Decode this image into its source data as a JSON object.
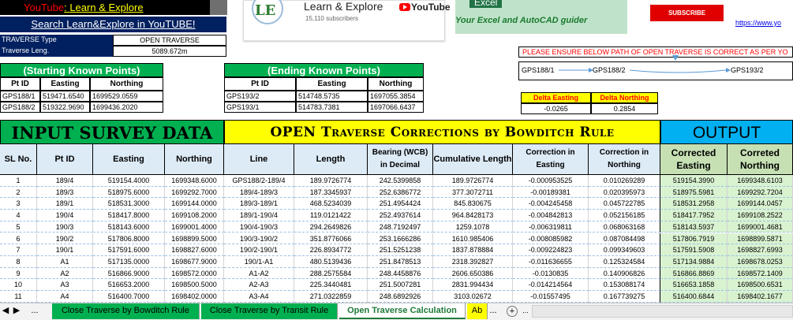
{
  "youtube_banner": {
    "prefix": "YouTube",
    "sep": ": ",
    "channel": "Learn & Explore"
  },
  "subscribe_banner": "Search Learn&Explore in YouTUBE!",
  "traverse_info": {
    "type_label": "TRAVERSE Type",
    "type_value": "OPEN TRAVERSE",
    "length_label": "Traverse Leng.",
    "length_value": "5089.672m"
  },
  "starting_points": {
    "title": "(Starting Known Points)",
    "headers": [
      "Pt ID",
      "Easting",
      "Northing"
    ],
    "rows": [
      [
        "GPS188/1",
        "519471.6540",
        "1699529.0559"
      ],
      [
        "GPS188/2",
        "519322.9690",
        "1699436.2020"
      ]
    ]
  },
  "ending_points": {
    "title": "(Ending Known Points)",
    "headers": [
      "Pt ID",
      "Easting",
      "Northing"
    ],
    "rows": [
      [
        "GPS193/2",
        "514748.5735",
        "1697055.3854"
      ],
      [
        "GPS193/1",
        "514783.7381",
        "1697066.6437"
      ]
    ]
  },
  "yt_card": {
    "logo": "LE",
    "channel": "Learn & Explore",
    "subscribers": "15,110 subscribers",
    "brand": "YouTube"
  },
  "excel_banner": {
    "tag": "Excel",
    "guide": "Your Excel and AutoCAD guider"
  },
  "subscribe_button": "SUBSCRIBE",
  "url_text": "https://www.yo",
  "warning": "PLEASE ENSURE BELOW PATH OF OPEN TRAVERSE IS CORRECT AS PER YO",
  "path": {
    "p1": "GPS188/1",
    "p2": "GPS188/2",
    "p3": "GPS193/2"
  },
  "delta": {
    "easting_label": "Delta Easting",
    "northing_label": "Delta Northing",
    "easting_value": "-0.0265",
    "northing_value": "0.2854"
  },
  "titles": {
    "input": "INPUT SURVEY DATA",
    "bowditch": "OPEN Traverse Corrections by Bowditch Rule",
    "output": "OUTPUT"
  },
  "table_headers": {
    "sl": "SL No.",
    "pt": "Pt ID",
    "easting": "Easting",
    "northing": "Northing",
    "line": "Line",
    "length": "Length",
    "bearing": "Bearing (WCB) in Decimal",
    "cumulative": "Cumulative Length",
    "corr_e": "Correction in Easting",
    "corr_n": "Correction in Northing",
    "cor_e": "Corrected Easting",
    "cor_n": "Correted Northing"
  },
  "rows": [
    [
      "1",
      "189/4",
      "519154.4000",
      "1699348.6000",
      "GPS188/2-189/4",
      "189.9726774",
      "242.5399858",
      "189.9726774",
      "-0.000953525",
      "0.010269289",
      "519154.3990",
      "1699348.6103"
    ],
    [
      "2",
      "189/3",
      "518975.6000",
      "1699292.7000",
      "189/4-189/3",
      "187.3345937",
      "252.6386772",
      "377.3072711",
      "-0.00189381",
      "0.020395973",
      "518975.5981",
      "1699292.7204"
    ],
    [
      "3",
      "189/1",
      "518531.3000",
      "1699144.0000",
      "189/3-189/1",
      "468.5234039",
      "251.4954424",
      "845.830675",
      "-0.004245458",
      "0.045722785",
      "518531.2958",
      "1699144.0457"
    ],
    [
      "4",
      "190/4",
      "518417.8000",
      "1699108.2000",
      "189/1-190/4",
      "119.0121422",
      "252.4937614",
      "964.8428173",
      "-0.004842813",
      "0.052156185",
      "518417.7952",
      "1699108.2522"
    ],
    [
      "5",
      "190/3",
      "518143.6000",
      "1699001.4000",
      "190/4-190/3",
      "294.2649826",
      "248.7192497",
      "1259.1078",
      "-0.006319811",
      "0.068063168",
      "518143.5937",
      "1699001.4681"
    ],
    [
      "6",
      "190/2",
      "517806.8000",
      "1698899.5000",
      "190/3-190/2",
      "351.8776066",
      "253.1666286",
      "1610.985406",
      "-0.008085982",
      "0.087084498",
      "517806.7919",
      "1698899.5871"
    ],
    [
      "7",
      "190/1",
      "517591.6000",
      "1698827.6000",
      "190/2-190/1",
      "226.8934772",
      "251.5251238",
      "1837.878884",
      "-0.009224823",
      "0.099349603",
      "517591.5908",
      "1698827.6993"
    ],
    [
      "8",
      "A1",
      "517135.0000",
      "1698677.9000",
      "190/1-A1",
      "480.5139436",
      "251.8478513",
      "2318.392827",
      "-0.011636655",
      "0.125324584",
      "517134.9884",
      "1698678.0253"
    ],
    [
      "9",
      "A2",
      "516866.9000",
      "1698572.0000",
      "A1-A2",
      "288.2575584",
      "248.4458876",
      "2606.650386",
      "-0.0130835",
      "0.140906826",
      "516866.8869",
      "1698572.1409"
    ],
    [
      "10",
      "A3",
      "516653.2000",
      "1698500.5000",
      "A2-A3",
      "225.3440481",
      "251.5007281",
      "2831.994434",
      "-0.014214564",
      "0.153088174",
      "516653.1858",
      "1698500.6531"
    ],
    [
      "11",
      "A4",
      "516400.7000",
      "1698402.0000",
      "A3-A4",
      "271.0322859",
      "248.6892926",
      "3103.02672",
      "-0.01557495",
      "0.167739275",
      "516400.6844",
      "1698402.1677"
    ]
  ],
  "tabs": {
    "nav_left": "◀",
    "nav_right": "▶",
    "ellipsis": "...",
    "tab1": "Close Traverse by Bowditch Rule",
    "tab2": "Close Traverse by Transit Rule",
    "tab3": "Open Traverse Calculation",
    "tab4": "Ab",
    "add": "+"
  },
  "colors": {
    "green": "#00b050",
    "yellow": "#ffff00",
    "cyan": "#00b0f0",
    "navy": "#002060"
  }
}
